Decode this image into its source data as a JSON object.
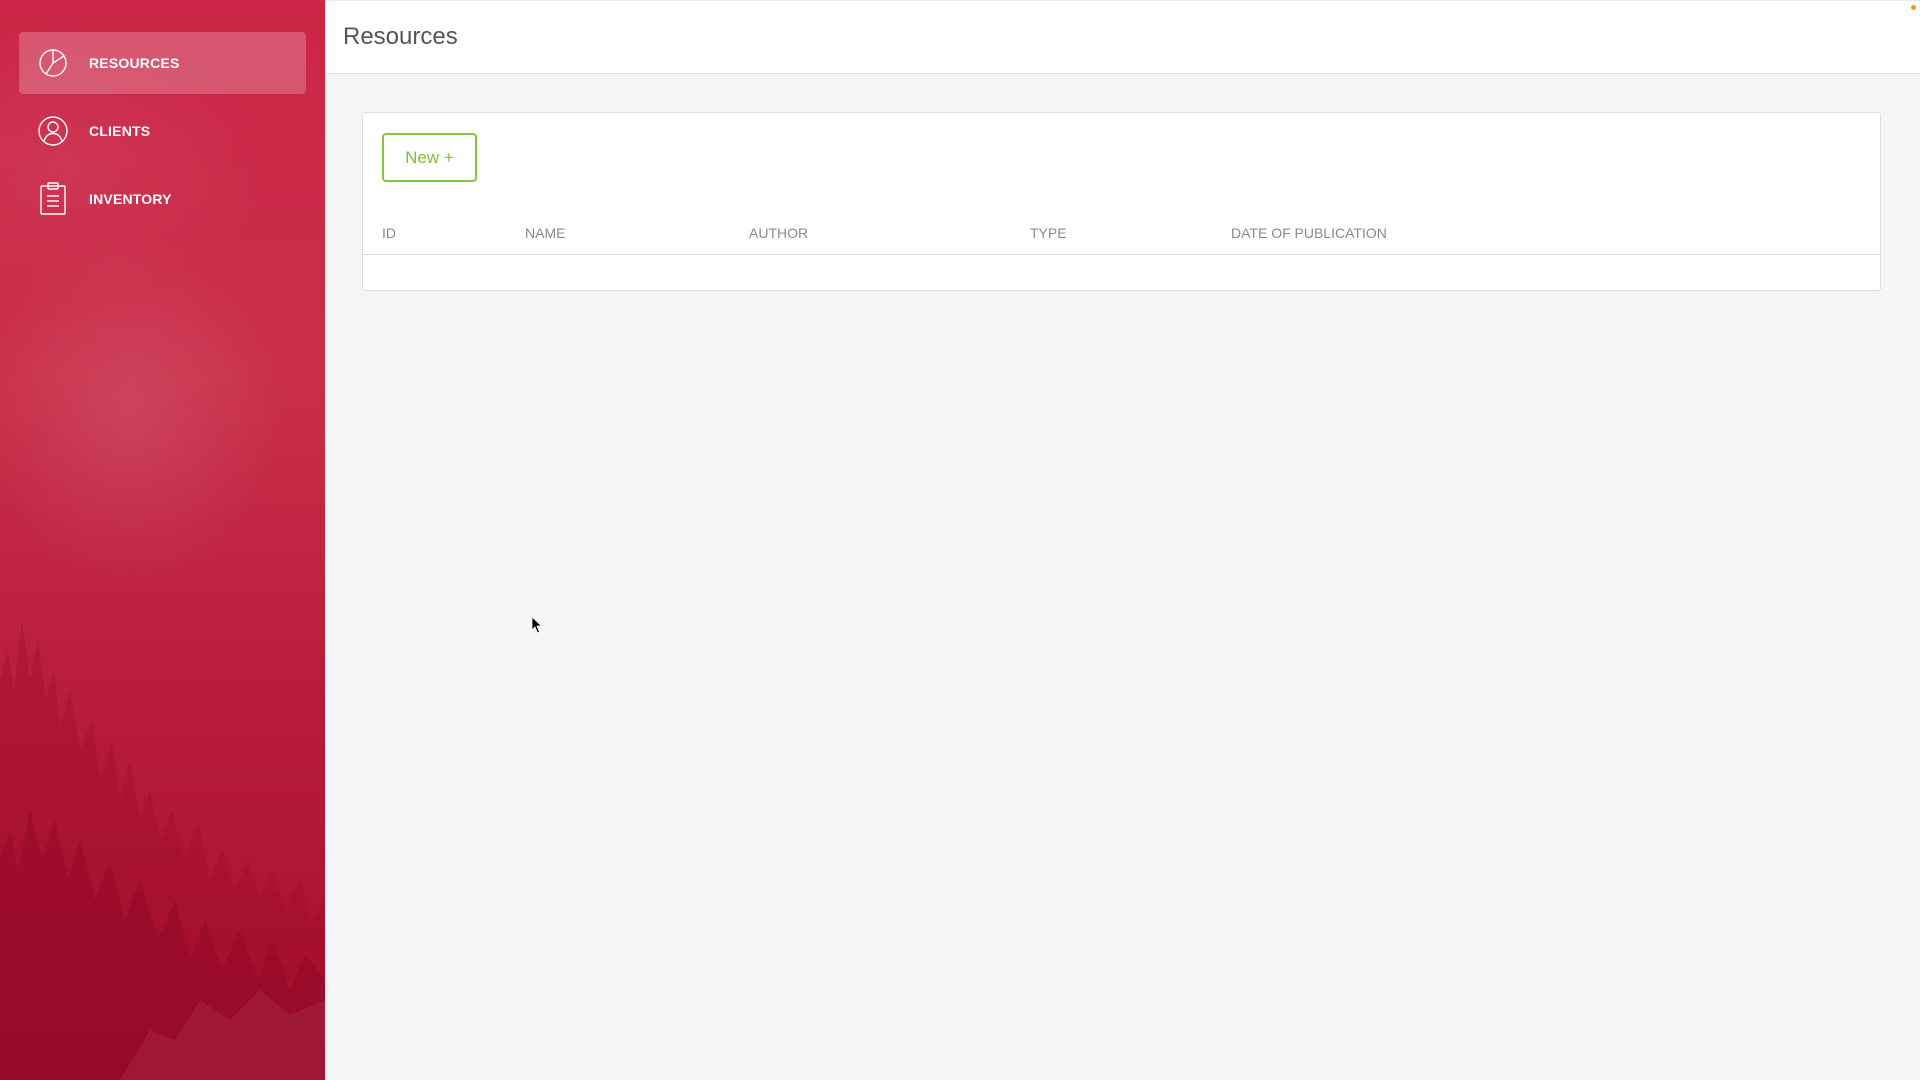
{
  "sidebar": {
    "items": [
      {
        "label": "RESOURCES",
        "icon": "pie-chart-icon",
        "active": true
      },
      {
        "label": "CLIENTS",
        "icon": "user-icon",
        "active": false
      },
      {
        "label": "INVENTORY",
        "icon": "clipboard-icon",
        "active": false
      }
    ]
  },
  "header": {
    "title": "Resources"
  },
  "toolbar": {
    "new_label": "New +"
  },
  "table": {
    "columns": [
      "ID",
      "NAME",
      "AUTHOR",
      "TYPE",
      "DATE OF PUBLICATION"
    ],
    "rows": []
  },
  "colors": {
    "sidebar": "#c92f4a",
    "accent_green": "#87c540",
    "notification_dot": "#f39c12"
  }
}
